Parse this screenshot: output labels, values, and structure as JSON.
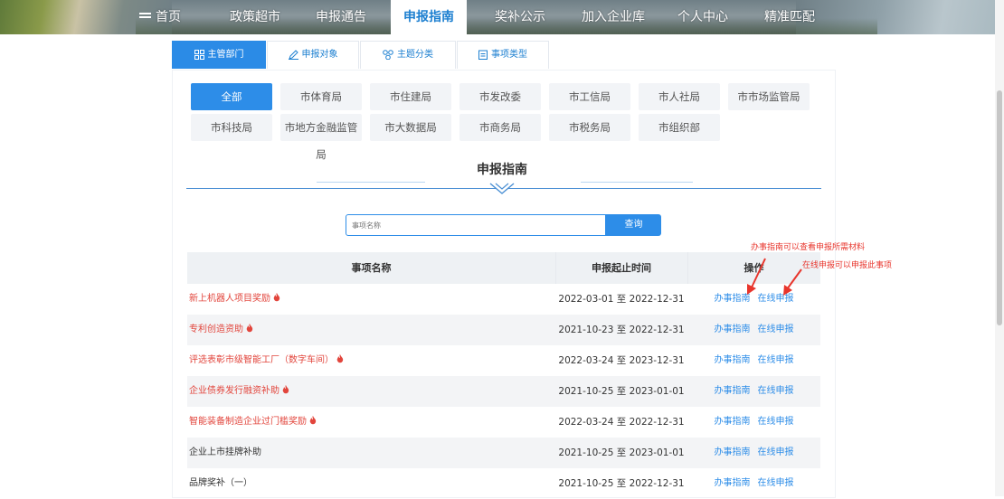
{
  "nav": {
    "items": [
      {
        "label": "首页"
      },
      {
        "label": "政策超市"
      },
      {
        "label": "申报通告"
      },
      {
        "label": "申报指南"
      },
      {
        "label": "奖补公示"
      },
      {
        "label": "加入企业库"
      },
      {
        "label": "个人中心"
      },
      {
        "label": "精准匹配"
      }
    ],
    "active": "申报指南"
  },
  "subtabs": [
    {
      "label": "主管部门",
      "icon": "grid-icon"
    },
    {
      "label": "申报对象",
      "icon": "pen-icon"
    },
    {
      "label": "主题分类",
      "icon": "share-icon"
    },
    {
      "label": "事项类型",
      "icon": "clipboard-icon"
    }
  ],
  "departments": [
    "全部",
    "市体育局",
    "市住建局",
    "市发改委",
    "市工信局",
    "市人社局",
    "市市场监管局",
    "市科技局",
    "市地方金融监管局",
    "市大数据局",
    "市商务局",
    "市税务局",
    "市组织部"
  ],
  "heading": "申报指南",
  "search": {
    "placeholder": "事项名称",
    "button": "查询"
  },
  "table": {
    "headers": [
      "事项名称",
      "申报起止时间",
      "操作"
    ],
    "op_guide": "办事指南",
    "op_apply": "在线申报",
    "rows": [
      {
        "name": "新上机器人项目奖励",
        "dates": "2022-03-01 至 2022-12-31",
        "hot": true
      },
      {
        "name": "专利创造资助",
        "dates": "2021-10-23 至 2022-12-31",
        "hot": true
      },
      {
        "name": "评选表彰市级智能工厂（数字车间）",
        "dates": "2022-03-24 至 2023-12-31",
        "hot": true
      },
      {
        "name": "企业债券发行融资补助",
        "dates": "2021-10-25 至 2023-01-01",
        "hot": true
      },
      {
        "name": "智能装备制造企业过门槛奖励",
        "dates": "2022-03-24 至 2022-12-31",
        "hot": true
      },
      {
        "name": "企业上市挂牌补助",
        "dates": "2021-10-25 至 2023-01-01",
        "hot": false
      },
      {
        "name": "品牌奖补（一）",
        "dates": "2021-10-25 至 2022-12-31",
        "hot": false
      }
    ]
  },
  "annotations": {
    "guide_note": "办事指南可以查看申报所需材料",
    "apply_note": "在线申报可以申报此事项"
  },
  "colors": {
    "primary": "#2d8de8",
    "hot": "#e2453c",
    "annotation": "#e8352c"
  }
}
